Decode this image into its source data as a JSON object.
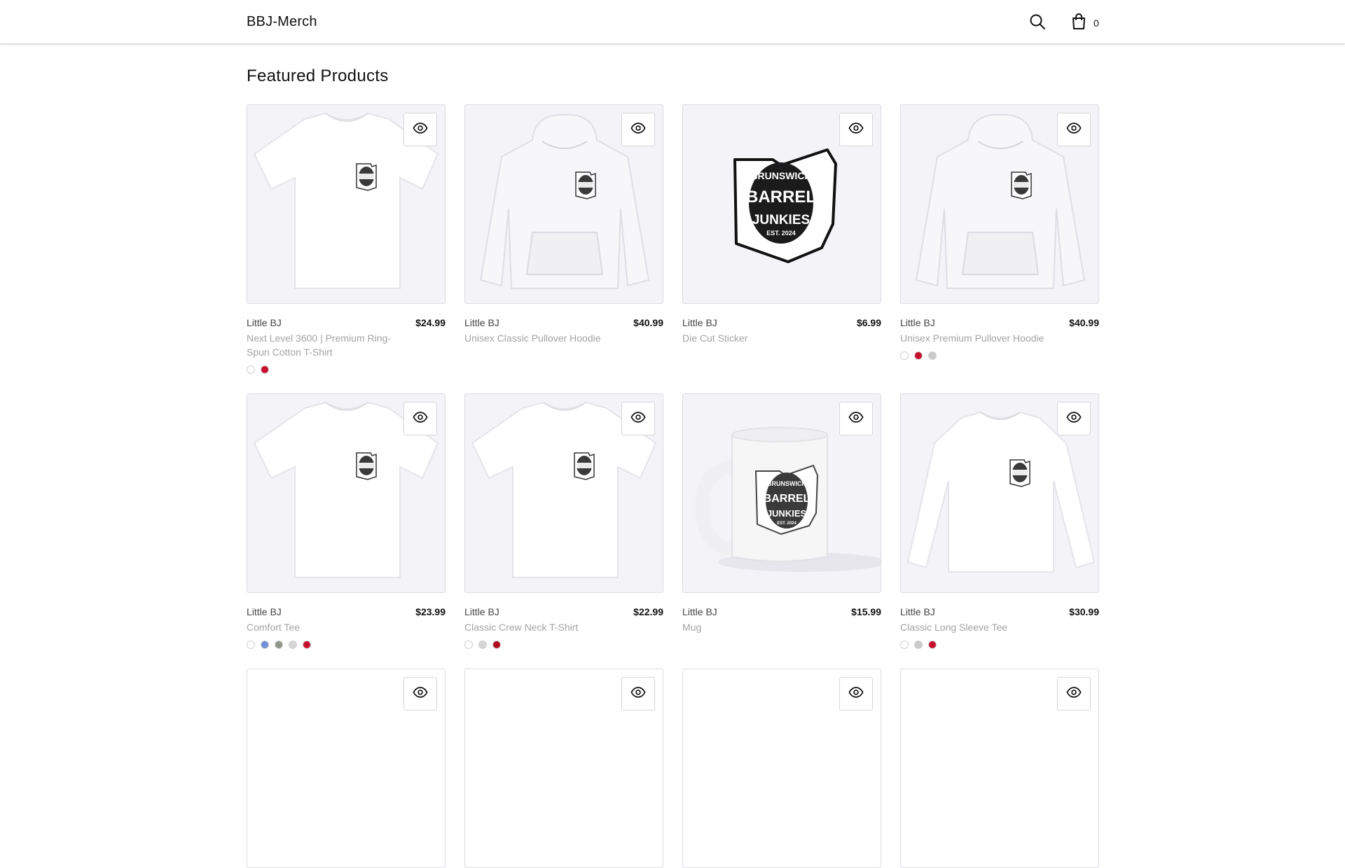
{
  "header": {
    "brand": "BBJ-Merch",
    "cart_count": "0",
    "icons": {
      "search": "search-icon",
      "cart": "shopping-bag-icon"
    }
  },
  "main": {
    "section_title": "Featured Products",
    "products": [
      {
        "vendor": "Little BJ",
        "price": "$24.99",
        "title": "Next Level 3600 | Premium Ring-Spun Cotton T-Shirt",
        "kind": "tshirt",
        "swatches": [
          "#ffffff",
          "#c8102e"
        ]
      },
      {
        "vendor": "Little BJ",
        "price": "$40.99",
        "title": "Unisex Classic Pullover Hoodie",
        "kind": "hoodie",
        "swatches": []
      },
      {
        "vendor": "Little BJ",
        "price": "$6.99",
        "title": "Die Cut Sticker",
        "kind": "sticker",
        "swatches": []
      },
      {
        "vendor": "Little BJ",
        "price": "$40.99",
        "title": "Unisex Premium Pullover Hoodie",
        "kind": "hoodie",
        "swatches": [
          "#ffffff",
          "#c8102e",
          "#c9c9c9"
        ]
      },
      {
        "vendor": "Little BJ",
        "price": "$23.99",
        "title": "Comfort Tee",
        "kind": "tshirt",
        "swatches": [
          "#ffffff",
          "#6f8fd6",
          "#8f9588",
          "#d6d6d6",
          "#c8102e"
        ]
      },
      {
        "vendor": "Little BJ",
        "price": "$22.99",
        "title": "Classic Crew Neck T-Shirt",
        "kind": "tshirt",
        "swatches": [
          "#ffffff",
          "#d6d6d6",
          "#b0101e"
        ]
      },
      {
        "vendor": "Little BJ",
        "price": "$15.99",
        "title": "Mug",
        "kind": "mug",
        "swatches": []
      },
      {
        "vendor": "Little BJ",
        "price": "$30.99",
        "title": "Classic Long Sleeve Tee",
        "kind": "longsleeve",
        "swatches": [
          "#ffffff",
          "#c9c9c9",
          "#c8102e"
        ]
      }
    ],
    "sticker_text": [
      "BRUNSWICK",
      "BARREL",
      "JUNKIES",
      "EST. 2024"
    ],
    "placeholder_cards": 4
  }
}
